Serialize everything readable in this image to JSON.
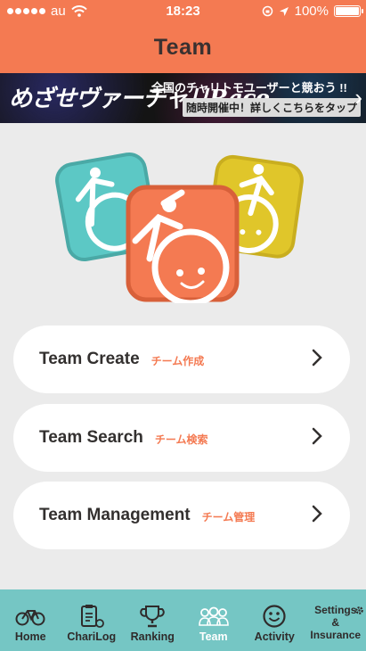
{
  "status_bar": {
    "carrier": "au",
    "time": "18:23",
    "battery": "100%"
  },
  "header": {
    "title": "Team"
  },
  "banner": {
    "logo_text": "めざせヴァーチャリRace",
    "headline": "全国のチャリトモユーザーと競おう !!",
    "subline": "随時開催中！詳しくこちらをタップ"
  },
  "menu": [
    {
      "label": "Team Create",
      "sub": "チーム作成"
    },
    {
      "label": "Team Search",
      "sub": "チーム検索"
    },
    {
      "label": "Team Management",
      "sub": "チーム管理"
    }
  ],
  "tabs": [
    {
      "label": "Home",
      "icon": "bicycle-icon"
    },
    {
      "label": "ChariLog",
      "icon": "clipboard-icon"
    },
    {
      "label": "Ranking",
      "icon": "trophy-icon"
    },
    {
      "label": "Team",
      "icon": "team-icon"
    },
    {
      "label": "Activity",
      "icon": "smiley-icon"
    },
    {
      "label": "Settings\n&\nInsurance",
      "icon": "gear-icon"
    }
  ],
  "colors": {
    "accent": "#f47a52",
    "tab_bar": "#75c6c4",
    "background": "#ebebeb",
    "icon_teal": "#5cc8c5",
    "icon_yellow": "#e0c62a"
  }
}
